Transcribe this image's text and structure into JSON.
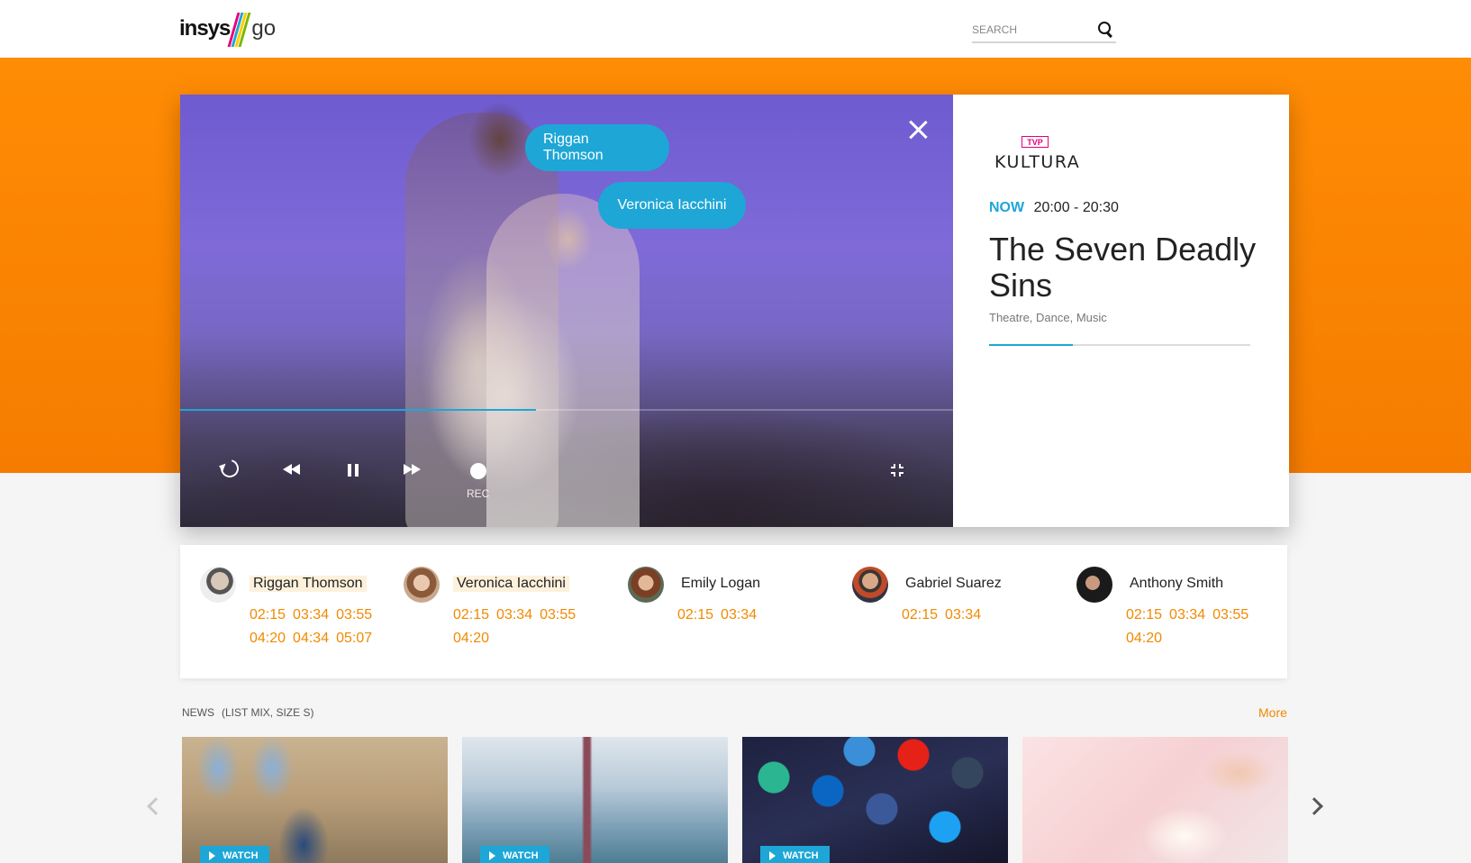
{
  "header": {
    "logo_text": "insys",
    "logo_go": "go",
    "search_placeholder": "SEARCH"
  },
  "player": {
    "bubbles": [
      "Riggan Thomson",
      "Veronica Iacchini"
    ],
    "playback_progress": 0.46,
    "rec_label": "REC"
  },
  "show": {
    "channel_badge": "TVP",
    "channel_name": "KULTURA",
    "now_label": "NOW",
    "time_range": "20:00 - 20:30",
    "title": "The Seven Deadly Sins",
    "genres": "Theatre, Dance, Music",
    "airing_progress": 0.32
  },
  "cast": [
    {
      "name": "Riggan Thomson",
      "highlighted": true,
      "times": [
        "02:15",
        "03:34",
        "03:55",
        "04:20",
        "04:34",
        "05:07"
      ]
    },
    {
      "name": "Veronica Iacchini",
      "highlighted": true,
      "times": [
        "02:15",
        "03:34",
        "03:55",
        "04:20"
      ]
    },
    {
      "name": "Emily Logan",
      "highlighted": false,
      "times": [
        "02:15",
        "03:34"
      ]
    },
    {
      "name": "Gabriel Suarez",
      "highlighted": false,
      "times": [
        "02:15",
        "03:34"
      ]
    },
    {
      "name": "Anthony Smith",
      "highlighted": false,
      "times": [
        "02:15",
        "03:34",
        "03:55",
        "04:20"
      ]
    }
  ],
  "news": {
    "title": "NEWS",
    "subtitle": "(LIST MIX, SIZE S)",
    "more_label": "More",
    "watch_label": "WATCH",
    "cards": [
      {
        "image": "ancient-ruins-tourist"
      },
      {
        "image": "shanghai-skyline"
      },
      {
        "image": "social-media-app-icons"
      },
      {
        "image": "handwriting-notebook"
      }
    ]
  },
  "colors": {
    "accent_orange": "#f57c00",
    "accent_blue": "#1ea6d6",
    "time_orange": "#f08a00"
  }
}
